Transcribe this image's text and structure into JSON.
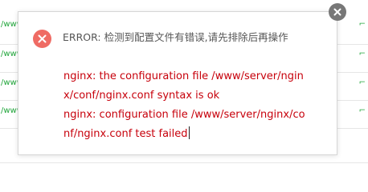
{
  "background_rows": {
    "left_fragments": [
      "/www",
      "/www",
      "/www",
      "/www"
    ],
    "right_fragments": [
      "",
      "",
      "",
      ""
    ]
  },
  "dialog": {
    "icon": "error-x-icon",
    "title": "ERROR: 检测到配置文件有错误,请先排除后再操作",
    "message_lines": [
      "nginx: the configuration file /www/server/ngin",
      "x/conf/nginx.conf syntax is ok",
      "nginx: configuration file /www/server/nginx/co",
      "nf/nginx.conf test failed"
    ],
    "close_icon": "close-icon"
  },
  "colors": {
    "error_icon_bg": "#ef6b64",
    "message_text": "#c7000b",
    "title_text": "#555555",
    "close_bg": "#777777",
    "row_link": "#20a53a"
  }
}
